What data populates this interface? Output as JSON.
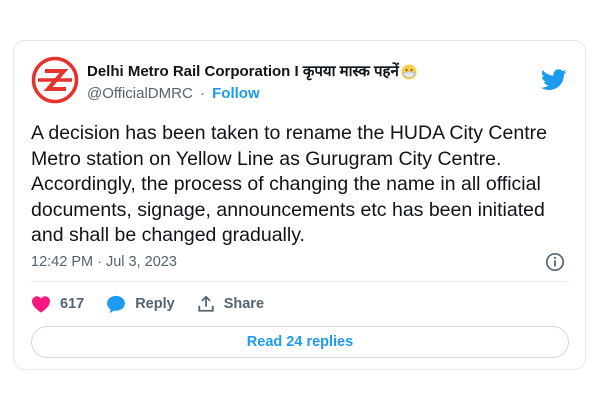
{
  "author": {
    "display_name": "Delhi Metro Rail Corporation I कृपया मास्क पहनें",
    "handle": "@OfficialDMRC",
    "separator": "·",
    "follow_label": "Follow"
  },
  "tweet": {
    "text": "A decision has been taken to rename the HUDA City Centre Metro station on Yellow Line as Gurugram City Centre. Accordingly, the process of changing the name in all official documents, signage, announcements etc has been initiated and shall be changed gradually.",
    "timestamp": "12:42 PM · Jul 3, 2023"
  },
  "actions": {
    "like_count": "617",
    "reply_label": "Reply",
    "share_label": "Share"
  },
  "replies_button": "Read 24 replies",
  "icons": [
    "dmrc-logo",
    "mask-emoji",
    "twitter-bird-icon",
    "info-icon",
    "heart-icon",
    "reply-icon",
    "share-icon"
  ],
  "colors": {
    "accent": "#1d9bf0",
    "like": "#f91880",
    "logo_red": "#e5322d",
    "text": "#0f1419",
    "secondary": "#536471"
  }
}
